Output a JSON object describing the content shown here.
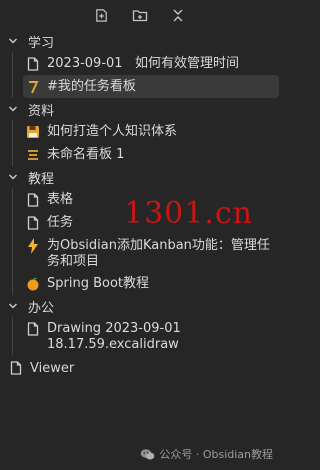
{
  "toolbar": {
    "buttons": [
      {
        "icon": "new-note-icon"
      },
      {
        "icon": "new-folder-icon"
      },
      {
        "icon": "collapse-all-icon"
      }
    ]
  },
  "folders": [
    {
      "name": "学习",
      "expanded": true,
      "items": [
        {
          "label": "2023-09-01   如何有效管理时间",
          "icon": "file-icon",
          "active": false
        },
        {
          "label": "#我的任务看板",
          "icon": "number-seven-icon",
          "active": true
        }
      ]
    },
    {
      "name": "资料",
      "expanded": true,
      "items": [
        {
          "label": "如何打造个人知识体系",
          "icon": "save-disk-icon",
          "active": false
        },
        {
          "label": "未命名看板 1",
          "icon": "list-lines-icon",
          "active": false
        }
      ]
    },
    {
      "name": "教程",
      "expanded": true,
      "items": [
        {
          "label": "表格",
          "icon": "file-icon",
          "active": false
        },
        {
          "label": "任务",
          "icon": "file-icon",
          "active": false
        },
        {
          "label": "为Obsidian添加Kanban功能：管理任务和项目",
          "icon": "lightning-icon",
          "active": false
        },
        {
          "label": "Spring Boot教程",
          "icon": "orange-fruit-icon",
          "active": false
        }
      ]
    },
    {
      "name": "办公",
      "expanded": true,
      "items": [
        {
          "label": "Drawing 2023-09-01 18.17.59.excalidraw",
          "icon": "file-icon",
          "active": false
        }
      ]
    }
  ],
  "root_file": {
    "label": "Viewer",
    "icon": "file-icon"
  },
  "overlay_watermark": "1301.cn",
  "footer_watermark": "公众号 · Obsidian教程",
  "colors": {
    "background": "#262626",
    "active_row": "#3a3a3a",
    "accent_orange": "#e6a43a",
    "watermark_red": "#d31414"
  }
}
